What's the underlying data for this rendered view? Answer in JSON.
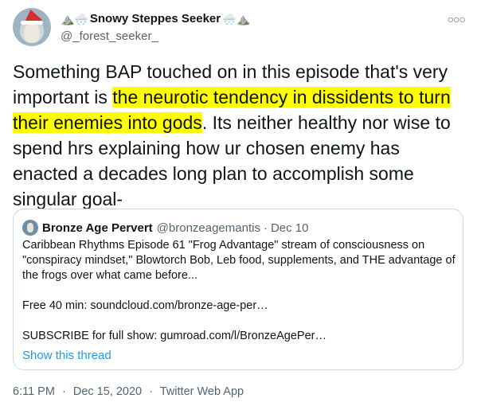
{
  "author": {
    "display_name": "Snowy Steppes Seeker",
    "handle": "@_forest_seeker_",
    "emoji_left": "⛰️🌨️",
    "emoji_right": "🌨️⛰️"
  },
  "tweet": {
    "text_before": "Something BAP touched on in this episode that's very important is ",
    "text_highlight": "the neurotic tendency in dissidents to turn their enemies into gods",
    "text_after": ". Its neither healthy nor wise to spend hrs explaining how ur chosen enemy has enacted a decades long plan to accomplish some singular goal-"
  },
  "quoted": {
    "name": "Bronze Age Pervert",
    "handle": "@bronzeagemantis",
    "separator": "·",
    "date": "Dec 10",
    "line1": "Caribbean Rhythms Episode 61 \"Frog Advantage\" stream of consciousness on \"conspiracy mindset,\" Blowtorch Bob, Leb food, supplements, and THE advantage of the frogs over what came before...",
    "line2": "Free 40 min: soundcloud.com/bronze-age-per…",
    "line3": "SUBSCRIBE for full show: gumroad.com/l/BronzeAgePer…",
    "show_thread": "Show this thread"
  },
  "meta": {
    "time": "6:11 PM",
    "sep": "·",
    "date": "Dec 15, 2020",
    "source": "Twitter Web App"
  },
  "colors": {
    "highlight": "#ffff00",
    "link": "#1d9bf0",
    "secondary": "#536471"
  }
}
